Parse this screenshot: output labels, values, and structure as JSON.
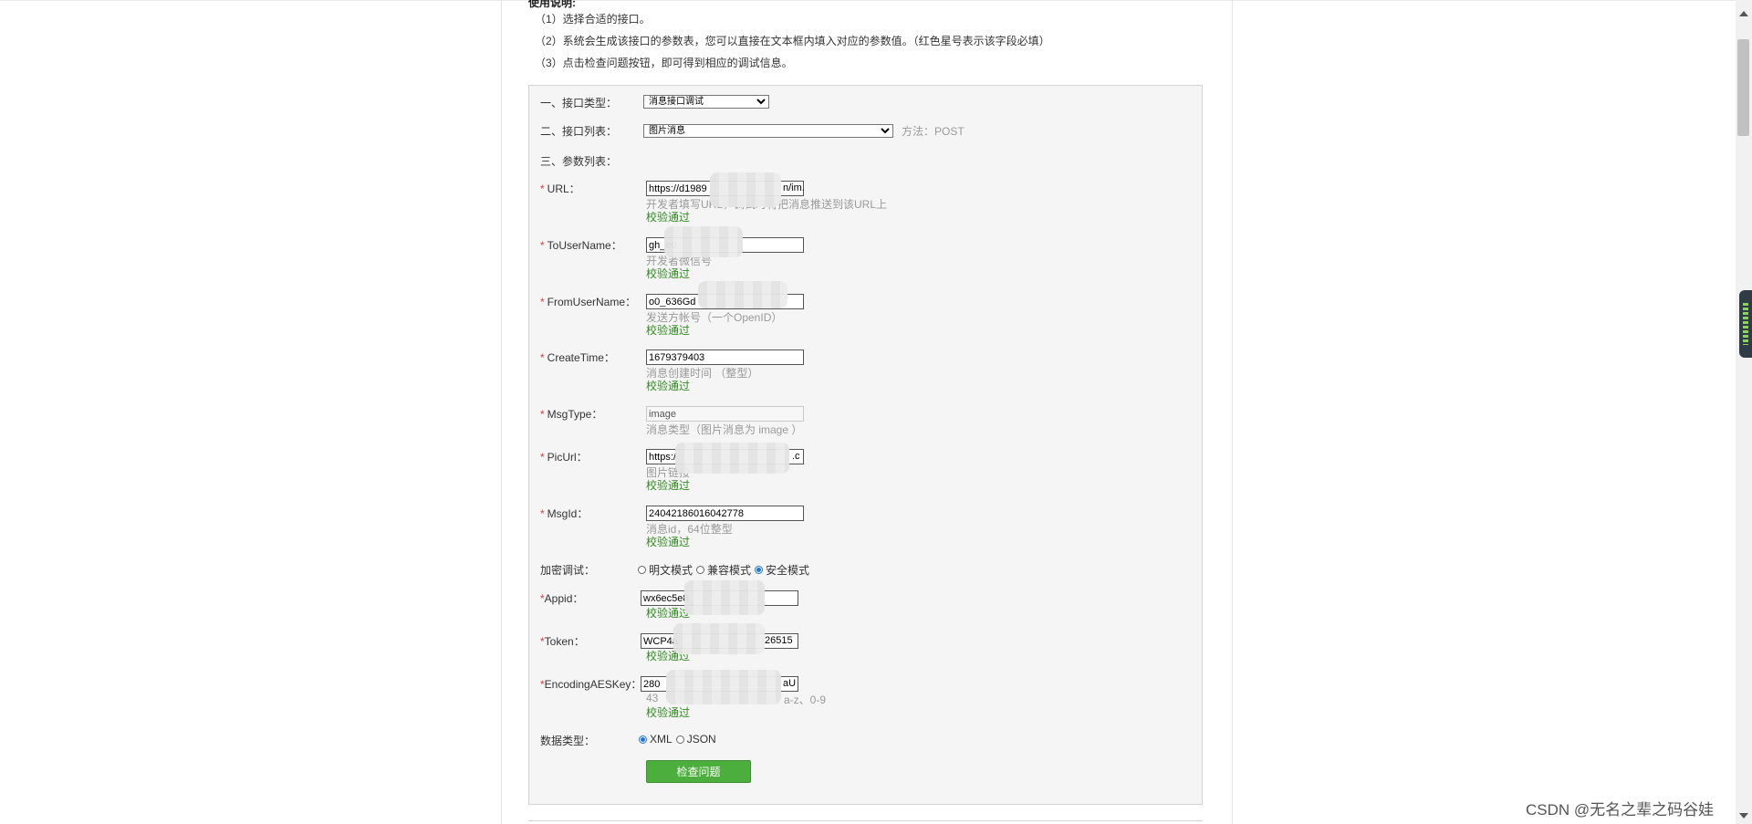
{
  "instructions": {
    "title": "使用说明:",
    "lines": [
      "（1）选择合适的接口。",
      "（2）系统会生成该接口的参数表，您可以直接在文本框内填入对应的参数值。（红色星号表示该字段必填）",
      "（3）点击检查问题按钮，即可得到相应的调试信息。"
    ]
  },
  "form": {
    "interface_type": {
      "label": "一、接口类型：",
      "value": "消息接口调试"
    },
    "interface_list": {
      "label": "二、接口列表：",
      "value": "图片消息",
      "method": "方法：POST"
    },
    "params_label": "三、参数列表：",
    "required_mark": "*",
    "fields": {
      "url": {
        "label": "URL：",
        "value": "https://d1989",
        "value_end": "n/im.",
        "hint": "开发者填写URL，调试时将把消息推送到该URL上",
        "status": "校验通过"
      },
      "to_user": {
        "label": "ToUserName：",
        "value": "gh_e0",
        "hint": "开发者微信号",
        "status": "校验通过"
      },
      "from_user": {
        "label": "FromUserName：",
        "value": "o0_636Gd",
        "hint": "发送方帐号（一个OpenID）",
        "status": "校验通过"
      },
      "create_time": {
        "label": "CreateTime：",
        "value": "1679379403",
        "hint": "消息创建时间 （整型）",
        "status": "校验通过"
      },
      "msg_type": {
        "label": "MsgType：",
        "value": "image",
        "hint": "消息类型（图片消息为 image ）"
      },
      "pic_url": {
        "label": "PicUrl：",
        "value": "https:/",
        "value_end": ".c",
        "hint": "图片链接",
        "status": "校验通过"
      },
      "msg_id": {
        "label": "MsgId：",
        "value": "24042186016042778",
        "hint": "消息id，64位整型",
        "status": "校验通过"
      }
    },
    "encryption": {
      "label": "加密调试：",
      "options": [
        "明文模式",
        "兼容模式",
        "安全模式"
      ],
      "selected": "安全模式"
    },
    "appid": {
      "label": "Appid：",
      "value": "wx6ec5e8",
      "status": "校验通过"
    },
    "token": {
      "label": "Token：",
      "value": "WCP4a",
      "value_end": "26515",
      "status": "校验通过"
    },
    "aes_key": {
      "label": "EncodingAESKey：",
      "value": "280",
      "value_end": "aU",
      "hint": "43",
      "hint_end": "a-z、0-9",
      "status": "校验通过"
    },
    "data_type": {
      "label": "数据类型：",
      "options": [
        "XML",
        "JSON"
      ],
      "selected": "XML"
    },
    "submit_label": "检查问题"
  },
  "watermark": "CSDN @无名之辈之码谷娃",
  "colors": {
    "required": "#e4393c",
    "ok": "#2f8a1f",
    "button": "#4cae3c",
    "panel_bg": "#f5f5f5"
  }
}
